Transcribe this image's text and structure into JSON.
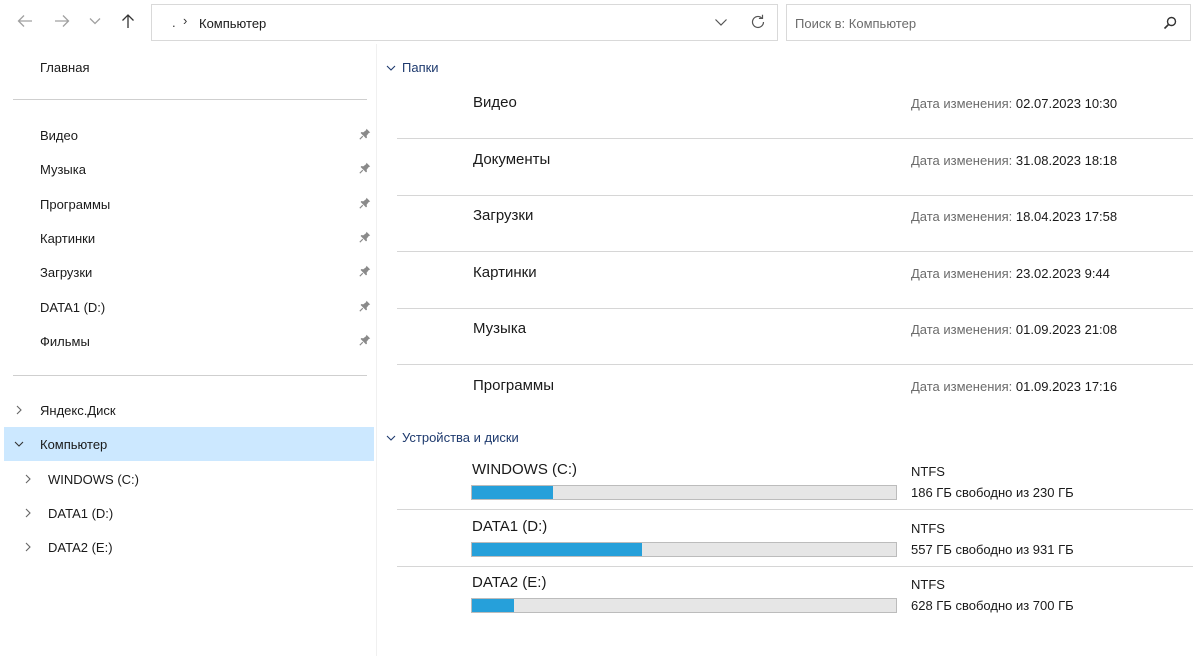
{
  "nav": {
    "back_icon": "arrow-left-icon",
    "forward_icon": "arrow-right-icon",
    "recent_icon": "chevron-down-icon",
    "up_icon": "arrow-up-icon"
  },
  "address": {
    "ellipsis": ".",
    "separator": "›",
    "crumb": "Компьютер"
  },
  "search": {
    "placeholder": "Поиск в: Компьютер"
  },
  "sidebar": {
    "home": "Главная",
    "pinned": [
      {
        "label": "Видео"
      },
      {
        "label": "Музыка"
      },
      {
        "label": "Программы"
      },
      {
        "label": "Картинки"
      },
      {
        "label": "Загрузки"
      },
      {
        "label": "DATA1 (D:)"
      },
      {
        "label": "Фильмы"
      }
    ],
    "tree": {
      "yandex": "Яндекс.Диск",
      "computer": "Компьютер",
      "drives": [
        {
          "label": "WINDOWS (C:)"
        },
        {
          "label": "DATA1 (D:)"
        },
        {
          "label": "DATA2 (E:)"
        }
      ]
    }
  },
  "content": {
    "folders_header": "Папки",
    "modified_label": "Дата изменения:",
    "folders": [
      {
        "name": "Видео",
        "modified": "02.07.2023 10:30"
      },
      {
        "name": "Документы",
        "modified": "31.08.2023 18:18"
      },
      {
        "name": "Загрузки",
        "modified": "18.04.2023 17:58"
      },
      {
        "name": "Картинки",
        "modified": "23.02.2023 9:44"
      },
      {
        "name": "Музыка",
        "modified": "01.09.2023 21:08"
      },
      {
        "name": "Программы",
        "modified": "01.09.2023 17:16"
      }
    ],
    "devices_header": "Устройства и диски",
    "drives": [
      {
        "name": "WINDOWS (C:)",
        "fs": "NTFS",
        "free_text": "186 ГБ свободно из 230 ГБ",
        "used_fraction": 0.19
      },
      {
        "name": "DATA1 (D:)",
        "fs": "NTFS",
        "free_text": "557 ГБ свободно из 931 ГБ",
        "used_fraction": 0.4
      },
      {
        "name": "DATA2 (E:)",
        "fs": "NTFS",
        "free_text": "628 ГБ свободно из 700 ГБ",
        "used_fraction": 0.1
      }
    ]
  },
  "colors": {
    "accent": "#26a0da",
    "selection": "#cce8ff",
    "group_header": "#1e3a6e"
  }
}
